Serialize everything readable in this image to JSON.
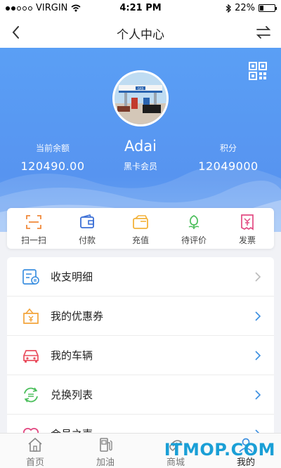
{
  "status_bar": {
    "carrier": "VIRGIN",
    "time": "4:21 PM",
    "battery": "22%",
    "battery_level": 0.22
  },
  "nav": {
    "title": "个人中心"
  },
  "profile": {
    "username": "Adai",
    "member_level": "黑卡会员",
    "balance_label": "当前余额",
    "balance_value": "120490.00",
    "points_label": "积分",
    "points_value": "12049000",
    "avatar_sign": "GAS"
  },
  "quick_actions": [
    {
      "label": "扫一扫",
      "icon": "scan-icon",
      "color": "#f08a3c"
    },
    {
      "label": "付款",
      "icon": "wallet-icon",
      "color": "#3b6fd6"
    },
    {
      "label": "充值",
      "icon": "recharge-icon",
      "color": "#f3b23a"
    },
    {
      "label": "待评价",
      "icon": "flower-icon",
      "color": "#4cbf5c"
    },
    {
      "label": "发票",
      "icon": "invoice-icon",
      "color": "#e24a82"
    }
  ],
  "menu": [
    {
      "label": "收支明细",
      "icon": "transaction-icon",
      "color": "#3b8fe0"
    },
    {
      "label": "我的优惠券",
      "icon": "coupon-icon",
      "color": "#f3a43a"
    },
    {
      "label": "我的车辆",
      "icon": "car-icon",
      "color": "#ea4f5f"
    },
    {
      "label": "兑换列表",
      "icon": "exchange-icon",
      "color": "#4cbf5c"
    },
    {
      "label": "会员之声",
      "icon": "heart-icon",
      "color": "#e24a82"
    }
  ],
  "tabs": [
    {
      "label": "首页",
      "icon": "home-icon"
    },
    {
      "label": "加油",
      "icon": "fuel-icon"
    },
    {
      "label": "商城",
      "icon": "mall-icon"
    },
    {
      "label": "我的",
      "icon": "user-icon",
      "active": true
    }
  ],
  "watermark": "ITMOP.COM",
  "colors": {
    "header": "#5794f0",
    "active_tab": "#3b8fe0"
  }
}
